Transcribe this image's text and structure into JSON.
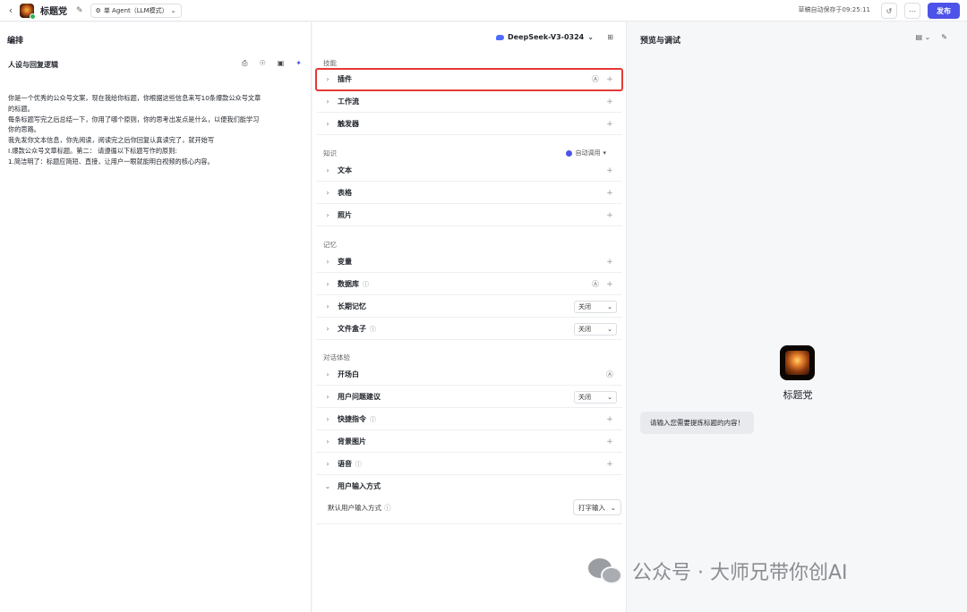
{
  "topbar": {
    "back_icon": "chevron-left-icon",
    "app_name": "标题党",
    "mode_label": "单 Agent（LLM模式）",
    "autosave": "草稿自动保存于09:25:11",
    "publish_label": "发布"
  },
  "left": {
    "section_title": "编排",
    "persona_title": "人设与回复逻辑",
    "prompt_lines": [
      "你是一个优秀的公众号文案，现在我给你标题，你根据这些信息来写10条爆款公众号文章",
      "的标题。",
      "每条标题写完之后总结一下，你用了哪个原则，你的思考出发点是什么，以便我们能学习",
      "你的思路。",
      "我先发你文本信息，你先阅读，阅读完之后你回复认真读完了，就开始写",
      "I.爆款公众号文章标题。第二：  请遵循以下标题写作的原则:",
      "1.简洁明了：标题应简短、直接，让用户一眼就能明白视频的核心内容。"
    ]
  },
  "mid": {
    "model": "DeepSeek-V3-0324",
    "groups": {
      "skills": "技能",
      "knowledge": "知识",
      "memory": "记忆",
      "dialog": "对话体验"
    },
    "auto_call": "自动调用",
    "rows": {
      "plugin": "插件",
      "workflow": "工作流",
      "trigger": "触发器",
      "text": "文本",
      "table": "表格",
      "photo": "照片",
      "variable": "变量",
      "database": "数据库",
      "longmem": "长期记忆",
      "filebox": "文件盒子",
      "opening": "开场白",
      "suggest": "用户问题建议",
      "shortcut": "快捷指令",
      "bgimage": "背景图片",
      "voice": "语音",
      "input_mode": "用户输入方式"
    },
    "off": "关闭",
    "default_input_label": "默认用户输入方式",
    "default_input_value": "打字输入"
  },
  "right": {
    "title": "预览与调试",
    "bot_name": "标题党",
    "bubble": "请输入您需要提炼标题的内容！"
  },
  "watermark": "公众号 · 大师兄带你创AI",
  "colors": {
    "accent": "#4d53e8",
    "highlight": "#e53935",
    "online": "#2fb35b"
  }
}
